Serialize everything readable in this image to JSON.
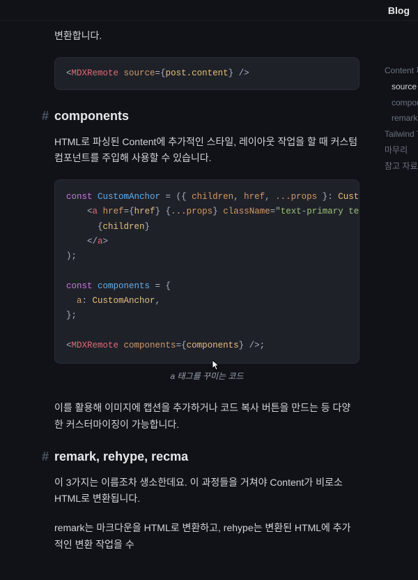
{
  "topbar": {
    "blog": "Blog"
  },
  "intro_tail": "변환합니다.",
  "code1": {
    "line1": {
      "open": "<",
      "tag": "MDXRemote",
      "attr": " source",
      "eq": "=",
      "brace_open": "{",
      "expr": "post.content",
      "brace_close": "}",
      "close": " />"
    }
  },
  "section1": {
    "hash": "#",
    "title": "components",
    "para": "HTML로 파싱된 Content에 추가적인 스타일, 레이아웃 작업을 할 때 커스텀 컴포넌트를 주입해 사용할 수 있습니다."
  },
  "code2": {
    "l1": {
      "const": "const",
      "name": " CustomAnchor",
      "eq": " = ",
      "paren_open": "(",
      "destruct_open": "{ ",
      "p1": "children",
      "c1": ", ",
      "p2": "href",
      "c2": ", ",
      "spread": "...props",
      "destruct_close": " }",
      "colon": ": ",
      "type": "CustomAnchorProps",
      "paren_close": ")",
      "arrow": " => ",
      "body_open": "("
    },
    "l2": {
      "indent": "    ",
      "open": "<",
      "tag": "a",
      "sp1": " ",
      "attr1": "href",
      "eq1": "=",
      "bo1": "{",
      "v1": "href",
      "bc1": "}",
      "sp2": " ",
      "bo2": "{",
      "spread": "...props",
      "bc2": "}",
      "sp3": " ",
      "attr2": "className",
      "eq2": "=",
      "str": "\"text-primary text-sm break-keep\"",
      "close": ">"
    },
    "l3": {
      "indent": "      ",
      "bo": "{",
      "v": "children",
      "bc": "}"
    },
    "l4": {
      "indent": "    ",
      "open": "</",
      "tag": "a",
      "close": ">"
    },
    "l5": {
      "text": ");"
    },
    "l6": {
      "text": ""
    },
    "l7": {
      "const": "const",
      "name": " components",
      "eq": " = ",
      "open": "{"
    },
    "l8": {
      "indent": "  ",
      "key": "a",
      "colon": ": ",
      "value": "CustomAnchor",
      "comma": ","
    },
    "l9": {
      "text": "};"
    },
    "l10": {
      "text": ""
    },
    "l11": {
      "open": "<",
      "tag": "MDXRemote",
      "sp": " ",
      "attr": "components",
      "eq": "=",
      "bo": "{",
      "v": "components",
      "bc": "}",
      "close": " />",
      "semi": ";"
    }
  },
  "caption1": "a 태그를 꾸미는 코드",
  "para2": "이를 활용해 이미지에 캡션을 추가하거나 코드 복사 버튼을 만드는 등 다양한 커스터마이징이 가능합니다.",
  "section2": {
    "hash": "#",
    "title": "remark, rehype, recma",
    "para1": "이 3가지는 이름조차 생소한데요. 이 과정들을 거쳐야 Content가 비로소 HTML로 변환됩니다.",
    "para2": "remark는 마크다운을 HTML로 변환하고, rehype는 변환된 HTML에 추가적인 변환 작업을 수"
  },
  "toc": {
    "i1": "Content 파",
    "i2": "source",
    "i3": "compon",
    "i4": "remark,",
    "i5": "Tailwind T",
    "i6": "마무리",
    "i7": "참고 자료"
  }
}
